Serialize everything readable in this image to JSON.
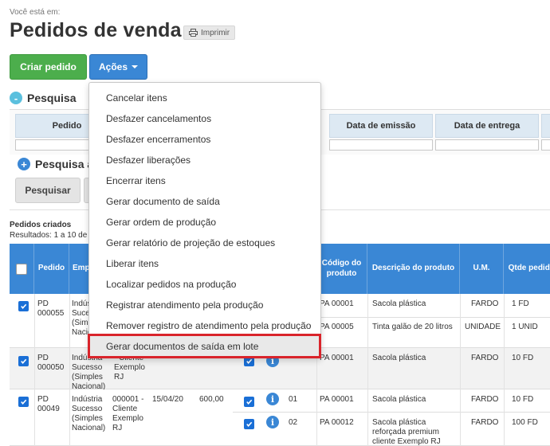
{
  "breadcrumb": "Você está em:",
  "title": "Pedidos de venda",
  "print_label": "Imprimir",
  "buttons": {
    "criar": "Criar pedido",
    "acoes": "Ações"
  },
  "search": {
    "title": "Pesquisa",
    "advanced_title": "Pesquisa a",
    "fields": [
      "Pedido",
      "Data de emissão",
      "Data de entrega"
    ],
    "search_button": "Pesquisar"
  },
  "results": {
    "title": "Pedidos criados",
    "count": "Resultados: 1 a 10 de"
  },
  "table": {
    "headers": [
      "Pedido",
      "Emp",
      "Código do produto",
      "Descrição do produto",
      "U.M.",
      "Qtde pedida"
    ],
    "orders": [
      {
        "pedido": "PD 000055",
        "empresa": "Indús Suces (Simp Nacio",
        "items": [
          {
            "codigo": "PA 00001",
            "descricao": "Sacola plástica",
            "um": "FARDO",
            "qtde": "1 FD"
          },
          {
            "codigo": "PA 00005",
            "descricao": "Tinta galão de 20 litros",
            "um": "UNIDADE",
            "qtde": "1 UNID"
          }
        ]
      },
      {
        "pedido": "PD 000050",
        "empresa": "Indústria Sucesso (Simples Nacional)",
        "cliente": "- Cliente Exemplo RJ",
        "items": [
          {
            "codigo": "PA 00001",
            "descricao": "Sacola plástica",
            "um": "FARDO",
            "qtde": "10 FD"
          }
        ]
      },
      {
        "pedido": "PD 00049",
        "empresa": "Indústria Sucesso (Simples Nacional)",
        "cliente": "000001 - Cliente Exemplo RJ",
        "data": "15/04/20",
        "valor": "600,00",
        "items": [
          {
            "seq": "01",
            "codigo": "PA 00001",
            "descricao": "Sacola plástica",
            "um": "FARDO",
            "qtde": "10 FD"
          },
          {
            "seq": "02",
            "codigo": "PA 00012",
            "descricao": "Sacola plástica reforçada premium cliente Exemplo RJ",
            "um": "FARDO",
            "qtde": "100 FD"
          }
        ]
      }
    ]
  },
  "dropdown": {
    "items": [
      "Cancelar itens",
      "Desfazer cancelamentos",
      "Desfazer encerramentos",
      "Desfazer liberações",
      "Encerrar itens",
      "Gerar documento de saída",
      "Gerar ordem de produção",
      "Gerar relatório de projeção de estoques",
      "Liberar itens",
      "Localizar pedidos na produção",
      "Registrar atendimento pela produção",
      "Remover registro de atendimento pela produção",
      "Gerar documentos de saída em lote"
    ],
    "selected_index": 12
  },
  "colors": {
    "primary": "#3a87d5",
    "success": "#4cae4c",
    "highlight": "#d9242b",
    "header_bg": "#dde9f3"
  }
}
